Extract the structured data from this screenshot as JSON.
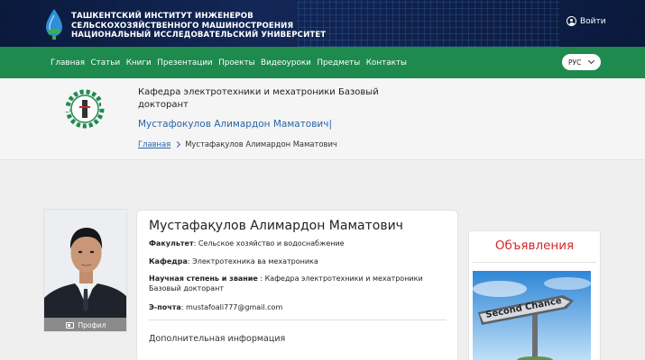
{
  "header": {
    "university_title": "ТАШКЕНТСКИЙ ИНСТИТУТ ИНЖЕНЕРОВ СЕЛЬСКОХОЗЯЙСТВЕННОГО МАШИНОСТРОЕНИЯ НАЦИОНАЛЬНЫЙ ИССЛЕДОВАТЕЛЬСКИЙ УНИВЕРСИТЕТ",
    "login_label": "Войти"
  },
  "nav": {
    "items": [
      "Главная",
      "Статьи",
      "Книги",
      "Презентации",
      "Проекты",
      "Видеоуроки",
      "Предметы",
      "Контакты"
    ],
    "language": "РУС"
  },
  "department": {
    "title": "Кафедра электротехники и мехатроники Базовый докторант",
    "person": "Мустафокулов Алимардон Маматович|",
    "breadcrumb_home": "Главная",
    "breadcrumb_current": "Мустафақулов Алимардон Маматович"
  },
  "profile": {
    "button_label": "Профил",
    "name": "Мустафақулов Алимардон Маматович",
    "faculty_label": "Факультет",
    "faculty_value": ": Сельское хозяйство и водоснабжение",
    "department_label": "Кафедра",
    "department_value": ": Электротехника ва мехатроника",
    "degree_label": "Научная степень и звание",
    "degree_value": " : Кафедра электротехники и мехатроники Базовый докторант",
    "email_label": "Э-почта",
    "email_value": ": mustafoali777@gmail.com",
    "extra_info": "Дополнительная информация"
  },
  "ads": {
    "title": "Объявления",
    "sign_text": "Second Chance"
  },
  "colors": {
    "nav_green": "#1e8a4e",
    "header_navy": "#0b1a3a",
    "link_blue": "#2a64a8",
    "ads_red": "#d4262b"
  }
}
